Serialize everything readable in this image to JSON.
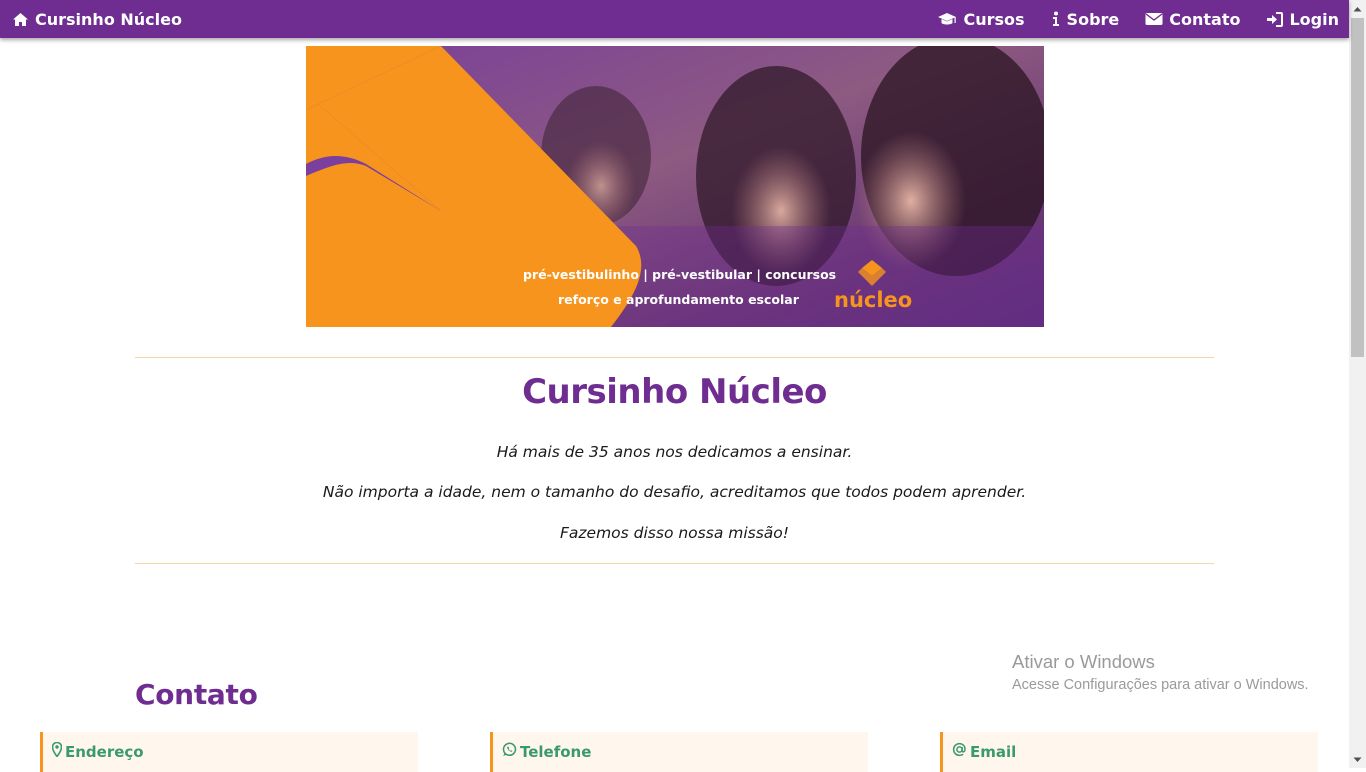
{
  "navbar": {
    "brand": "Cursinho Núcleo",
    "brand_icon": "home-icon",
    "links": [
      {
        "label": "Cursos",
        "icon": "graduation-cap-icon"
      },
      {
        "label": "Sobre",
        "icon": "info-icon"
      },
      {
        "label": "Contato",
        "icon": "envelope-icon"
      },
      {
        "label": "Login",
        "icon": "sign-in-icon"
      }
    ],
    "color": "#6f2c91"
  },
  "banner": {
    "tagline_1": "pré-vestibulinho | pré-vestibular | concursos",
    "tagline_2": "reforço e aprofundamento escolar",
    "logo_text": "núcleo",
    "accent_color": "#f7941d"
  },
  "hero": {
    "title": "Cursinho Núcleo",
    "lines": [
      "Há mais de 35 anos nos dedicamos a ensinar.",
      "Não importa a idade, nem o tamanho do desafio, acreditamos que todos podem aprender.",
      "Fazemos disso nossa missão!"
    ]
  },
  "contact": {
    "title": "Contato",
    "cards": [
      {
        "label": "Endereço",
        "icon": "map-marker-icon"
      },
      {
        "label": "Telefone",
        "icon": "whatsapp-icon"
      },
      {
        "label": "Email",
        "icon": "at-icon"
      }
    ]
  },
  "watermark": {
    "title": "Ativar o Windows",
    "subtitle": "Acesse Configurações para ativar o Windows."
  }
}
